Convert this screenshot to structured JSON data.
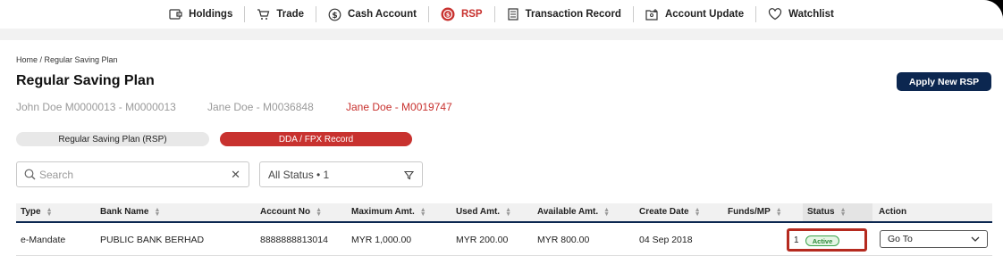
{
  "nav": {
    "items": [
      {
        "label": "Holdings",
        "icon": "holdings-icon"
      },
      {
        "label": "Trade",
        "icon": "cart-icon"
      },
      {
        "label": "Cash Account",
        "icon": "dollar-icon"
      },
      {
        "label": "RSP",
        "icon": "rsp-icon"
      },
      {
        "label": "Transaction Record",
        "icon": "document-icon"
      },
      {
        "label": "Account Update",
        "icon": "account-update-icon"
      },
      {
        "label": "Watchlist",
        "icon": "heart-icon"
      }
    ],
    "active_color": "#c8322f"
  },
  "breadcrumb": "Home / Regular Saving Plan",
  "page_title": "Regular Saving Plan",
  "apply_button": "Apply New RSP",
  "accounts": [
    "John Doe M0000013 - M0000013",
    "Jane Doe - M0036848",
    "Jane Doe - M0019747"
  ],
  "tabs": {
    "rsp": "Regular Saving Plan (RSP)",
    "dda": "DDA / FPX Record"
  },
  "search": {
    "placeholder": "Search"
  },
  "status_filter": {
    "value": "All Status • 1"
  },
  "table": {
    "headers": {
      "type": "Type",
      "bank_name": "Bank Name",
      "account_no": "Account No",
      "max_amt": "Maximum Amt.",
      "used_amt": "Used Amt.",
      "avail_amt": "Available Amt.",
      "create_date": "Create Date",
      "funds": "Funds/MP",
      "status": "Status",
      "action": "Action"
    },
    "rows": [
      {
        "type": "e-Mandate",
        "bank_name": "PUBLIC BANK BERHAD",
        "account_no": "8888888813014",
        "max_amt": "MYR 1,000.00",
        "used_amt": "MYR 200.00",
        "avail_amt": "MYR 800.00",
        "create_date": "04 Sep 2018",
        "funds": "",
        "status_num": "1",
        "status": "Active",
        "action": "Go To"
      }
    ]
  },
  "colors": {
    "brand_navy": "#0c2750",
    "brand_red": "#c8322f",
    "active_green": "#3aa34a"
  }
}
